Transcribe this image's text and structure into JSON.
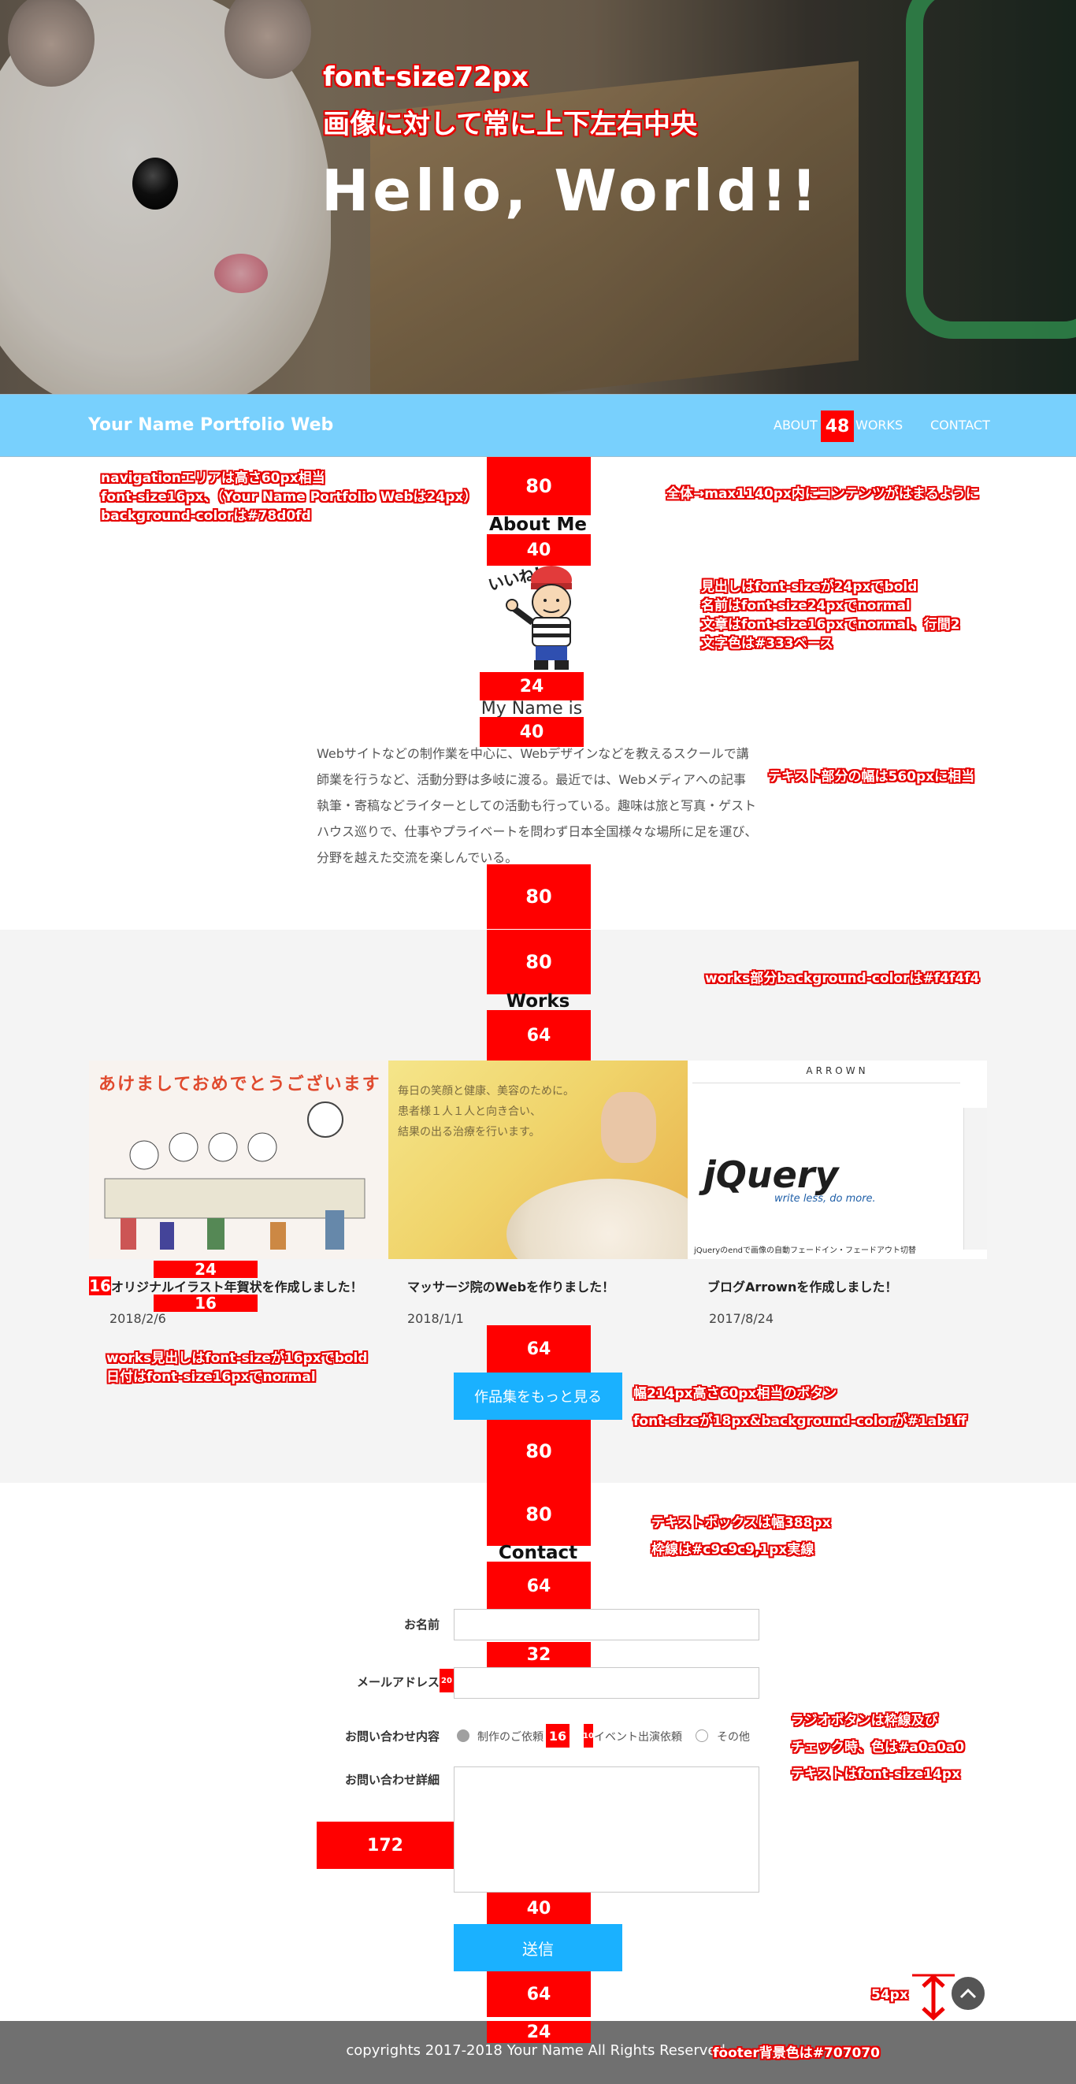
{
  "hero": {
    "title": "Hello, World!!",
    "note_font": "font-size72px",
    "note_center": "画像に対して常に上下左右中央"
  },
  "nav": {
    "brand": "Your Name Portfolio Web",
    "links": [
      "ABOUT",
      "WORKS",
      "CONTACT"
    ],
    "gap_marker": "48",
    "background": "#78d0fd"
  },
  "notes": {
    "nav": [
      "navigationエリアは高さ60px相当",
      "font-size16px、（Your Name Portfolio Webは24px）",
      "background-colorは#78d0fd"
    ],
    "container": "全体→max1140px内にコンテンツがはまるように",
    "about": [
      "見出しはfont-sizeが24pxでbold",
      "名前はfont-size24pxでnormal",
      "文章はfont-size16pxでnormal、行間2",
      "文字色は#333ベース"
    ],
    "text_width": "テキスト部分の幅は560pxに相当",
    "works_bg": "works部分background-colorは#f4f4f4",
    "works_title": [
      "works見出しはfont-sizeが16pxでbold",
      "日付はfont-size16pxでnormal"
    ],
    "button": [
      "幅214px高さ60px相当のボタン",
      "font-sizeが18px&background-colorが#1ab1ff"
    ],
    "textbox": [
      "テキストボックスは幅388px",
      "枠線は#c9c9c9,1px実線"
    ],
    "radio": [
      "ラジオボタンは枠線及び",
      "チェック時、色は#a0a0a0",
      "テキストはfont-size14px"
    ],
    "totop": "54px",
    "footer": "footer背景色は#707070"
  },
  "spacers": {
    "about_top": "80",
    "about_title_gap": "40",
    "avatar_gap": "24",
    "name_gap": "40",
    "about_bottom": "80",
    "works_top": "80",
    "works_title_gap": "64",
    "works_caption_top": "24",
    "works_caption_left": "16",
    "works_caption_bottom": "16",
    "works_btn_gap": "64",
    "works_bottom": "80",
    "contact_top": "80",
    "contact_title_gap": "64",
    "field_gap": "32",
    "label_gap": "20",
    "radio_gap": "16",
    "radio_gap_small": "10",
    "textarea_label": "172",
    "send_gap": "40",
    "footer_gap": "64",
    "footer_text_gap": "24"
  },
  "about": {
    "title": "About Me",
    "name": "My Name is",
    "text": "Webサイトなどの制作業を中心に、Webデザインなどを教えるスクールで講師業を行うなど、活動分野は多岐に渡る。最近では、Webメディアへの記事執筆・寄稿などライターとしての活動も行っている。趣味は旅と写真・ゲストハウス巡りで、仕事やプライベートを問わず日本全国様々な場所に足を運び、分野を越えた交流を楽しんでいる。"
  },
  "works": {
    "title": "Works",
    "items": [
      {
        "title": "オリジナルイラスト年賀状を作成しました！",
        "date": "2018/2/6",
        "image_text": "あけましておめでとうございます"
      },
      {
        "title": "マッサージ院のWebを作りました！",
        "date": "2018/1/1",
        "image_text": "毎日の笑顔と健康、美容のために。\n患者様１人１人と向き合い、\n結果の出る治療を行います。"
      },
      {
        "title": "ブログArrownを作成しました！",
        "date": "2017/8/24",
        "image_text": "ARROWN",
        "logo": "jQuery",
        "logo_sub": "write less, do more.",
        "caption": "jQueryのendで画像の自動フェードイン・フェードアウト切替"
      }
    ],
    "more_button": "作品集をもっと見る"
  },
  "contact": {
    "title": "Contact",
    "name_label": "お名前",
    "email_label": "メールアドレス",
    "type_label": "お問い合わせ内容",
    "radios": [
      {
        "label": "制作のご依頼",
        "checked": true
      },
      {
        "label": "イベント出演依頼",
        "checked": false
      },
      {
        "label": "その他",
        "checked": false
      }
    ],
    "detail_label": "お問い合わせ詳細",
    "send_button": "送信"
  },
  "footer": {
    "copyright": "copyrights 2017-2018 Your Name  All Rights Reserved."
  }
}
